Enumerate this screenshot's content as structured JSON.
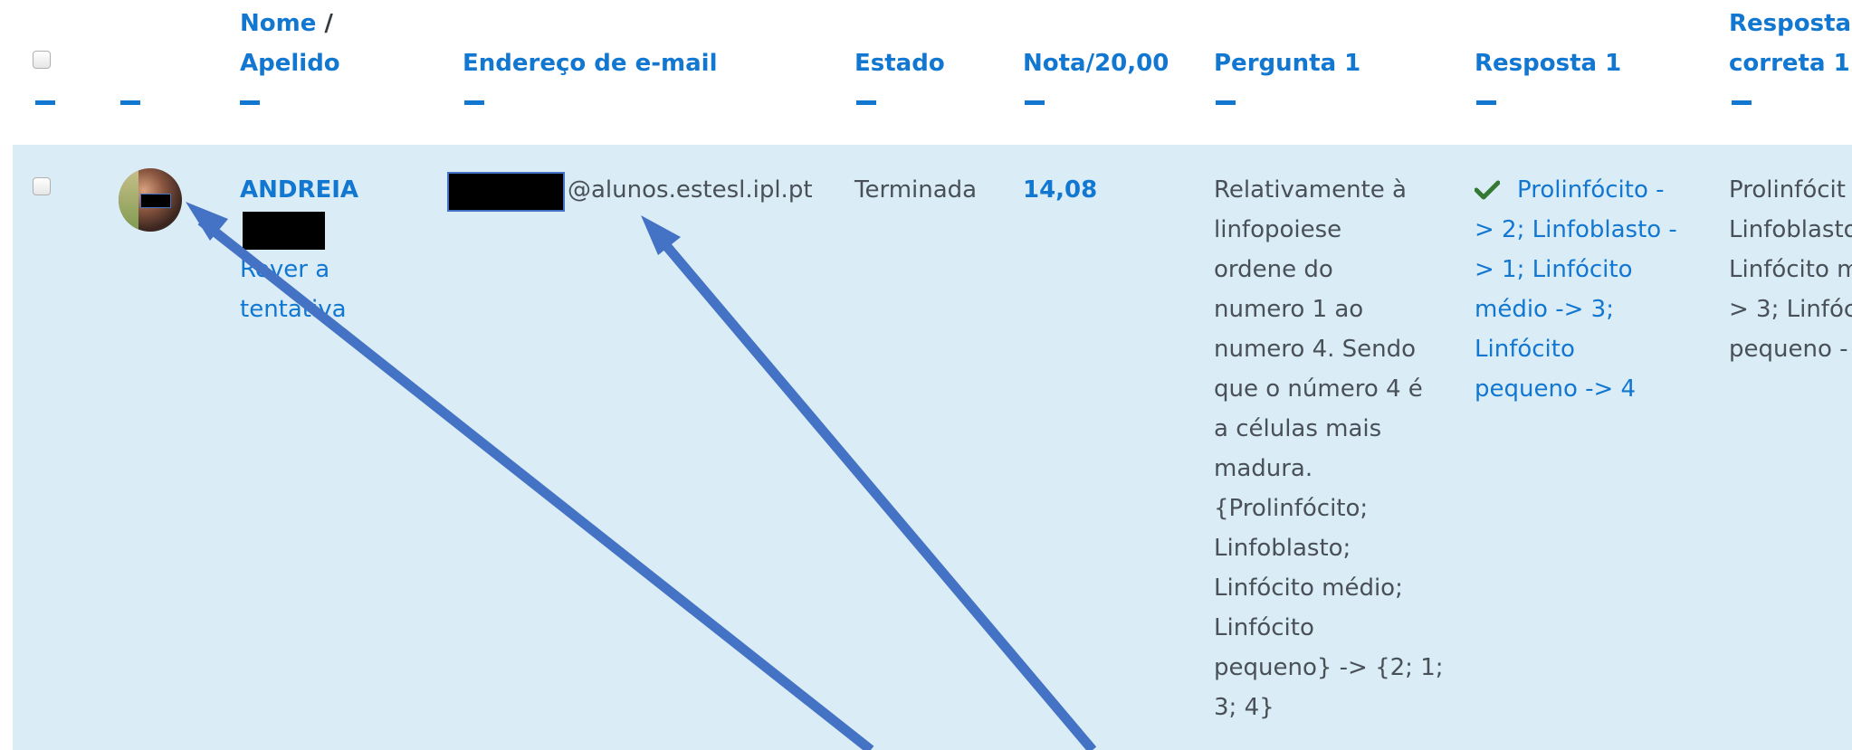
{
  "header": {
    "name_label": "Nome",
    "name_sep": "/",
    "surname_label": "Apelido",
    "email_label": "Endereço de e-mail",
    "state_label": "Estado",
    "grade_label": "Nota/20,00",
    "question1_label": "Pergunta 1",
    "answer1_label": "Resposta 1",
    "correct1_label_line1": "Resposta",
    "correct1_label_line2": "correta 1"
  },
  "row": {
    "first_name": "ANDREIA",
    "review_line1": "Rever a",
    "review_line2": "tentativa",
    "email_domain": "@alunos.estesl.ipl.pt",
    "state": "Terminada",
    "grade": "14,08",
    "question_lines": [
      "Relativamente à",
      "linfopoiese",
      "ordene do",
      "numero 1 ao",
      "numero 4. Sendo",
      "que o número 4 é",
      "a células mais",
      "madura.",
      "{Prolinfócito;",
      "Linfoblasto;",
      "Linfócito médio;",
      "Linfócito",
      "pequeno} -> {2; 1;",
      "3; 4}"
    ],
    "answer_lines": [
      "Prolinfócito -",
      "> 2; Linfoblasto -",
      "> 1; Linfócito",
      "médio -> 3;",
      "Linfócito",
      "pequeno -> 4"
    ],
    "correct_lines": [
      "Prolinfócit",
      "Linfoblasto",
      "Linfócito m",
      "> 3; Linfóc",
      "pequeno -"
    ]
  },
  "icons": {
    "check": "check-icon",
    "avatar": "user-avatar"
  },
  "colors": {
    "link": "#1177d1",
    "row_bg": "#daecf6",
    "check": "#357a32",
    "arrow": "#4472c4"
  }
}
